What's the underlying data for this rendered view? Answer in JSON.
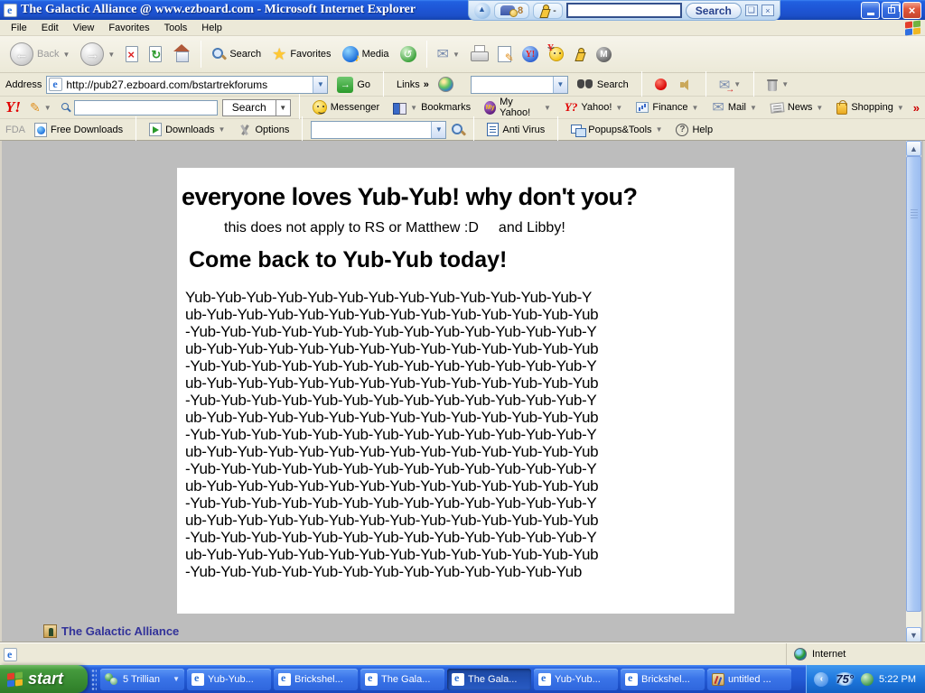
{
  "window": {
    "title": "The Galactic Alliance @ www.ezboard.com - Microsoft Internet Explorer"
  },
  "deskbar": {
    "mail_count": "8",
    "aim_status": "-",
    "search_value": "",
    "search_button": "Search"
  },
  "menu_bar": {
    "items": [
      "File",
      "Edit",
      "View",
      "Favorites",
      "Tools",
      "Help"
    ]
  },
  "toolbar": {
    "back_label": "Back",
    "search_label": "Search",
    "favorites_label": "Favorites",
    "media_label": "Media"
  },
  "address_bar": {
    "label": "Address",
    "url": "http://pub27.ezboard.com/bstartrekforums",
    "go_label": "Go",
    "links_label": "Links",
    "links_chevron": "»",
    "search_value": "",
    "search_label": "Search"
  },
  "yahoo_toolbar": {
    "logo": "Y!",
    "search_value": "",
    "search_button": "Search",
    "messenger_label": "Messenger",
    "bookmarks_label": "Bookmarks",
    "my_yahoo_label": "My Yahoo!",
    "yahoo_label": "Yahoo!",
    "finance_label": "Finance",
    "mail_label": "Mail",
    "news_label": "News",
    "shopping_label": "Shopping",
    "overflow_chevron": "»"
  },
  "fda_toolbar": {
    "fda_label": "FDA",
    "free_downloads_label": "Free Downloads",
    "downloads_label": "Downloads",
    "options_label": "Options",
    "search_value": "",
    "anti_virus_label": "Anti Virus",
    "popups_label": "Popups&Tools",
    "help_label": "Help"
  },
  "page": {
    "heading": "everyone loves Yub-Yub! why don't you?",
    "subheading_main": "this does not apply to RS or Matthew :D",
    "subheading_extra": "and Libby!",
    "heading2": "Come back to Yub-Yub today!",
    "yub_lines": [
      "Yub-Yub-Yub-Yub-Yub-Yub-Yub-Yub-Yub-Yub-Yub-Yub-Yub-Y",
      "ub-Yub-Yub-Yub-Yub-Yub-Yub-Yub-Yub-Yub-Yub-Yub-Yub-Yub",
      "-Yub-Yub-Yub-Yub-Yub-Yub-Yub-Yub-Yub-Yub-Yub-Yub-Yub-Y",
      "ub-Yub-Yub-Yub-Yub-Yub-Yub-Yub-Yub-Yub-Yub-Yub-Yub-Yub",
      "-Yub-Yub-Yub-Yub-Yub-Yub-Yub-Yub-Yub-Yub-Yub-Yub-Yub-Y",
      "ub-Yub-Yub-Yub-Yub-Yub-Yub-Yub-Yub-Yub-Yub-Yub-Yub-Yub",
      "-Yub-Yub-Yub-Yub-Yub-Yub-Yub-Yub-Yub-Yub-Yub-Yub-Yub-Y",
      "ub-Yub-Yub-Yub-Yub-Yub-Yub-Yub-Yub-Yub-Yub-Yub-Yub-Yub",
      "-Yub-Yub-Yub-Yub-Yub-Yub-Yub-Yub-Yub-Yub-Yub-Yub-Yub-Y",
      "ub-Yub-Yub-Yub-Yub-Yub-Yub-Yub-Yub-Yub-Yub-Yub-Yub-Yub",
      "-Yub-Yub-Yub-Yub-Yub-Yub-Yub-Yub-Yub-Yub-Yub-Yub-Yub-Y",
      "ub-Yub-Yub-Yub-Yub-Yub-Yub-Yub-Yub-Yub-Yub-Yub-Yub-Yub",
      "-Yub-Yub-Yub-Yub-Yub-Yub-Yub-Yub-Yub-Yub-Yub-Yub-Yub-Y",
      "ub-Yub-Yub-Yub-Yub-Yub-Yub-Yub-Yub-Yub-Yub-Yub-Yub-Yub",
      "-Yub-Yub-Yub-Yub-Yub-Yub-Yub-Yub-Yub-Yub-Yub-Yub-Yub-Y",
      "ub-Yub-Yub-Yub-Yub-Yub-Yub-Yub-Yub-Yub-Yub-Yub-Yub-Yub",
      "-Yub-Yub-Yub-Yub-Yub-Yub-Yub-Yub-Yub-Yub-Yub-Yub-Yub"
    ],
    "footer_link": "The Galactic Alliance"
  },
  "status_bar": {
    "zone_label": "Internet"
  },
  "taskbar": {
    "start_label": "start",
    "buttons": [
      {
        "label": "5 Trillian",
        "app": "trillian",
        "grouped": true,
        "active": false
      },
      {
        "label": "Yub-Yub...",
        "app": "ie",
        "active": false
      },
      {
        "label": "Brickshel...",
        "app": "ie",
        "active": false
      },
      {
        "label": "The Gala...",
        "app": "ie",
        "active": false
      },
      {
        "label": "The Gala...",
        "app": "ie",
        "active": true
      },
      {
        "label": "Yub-Yub...",
        "app": "ie",
        "active": false
      },
      {
        "label": "Brickshel...",
        "app": "ie",
        "active": false
      },
      {
        "label": "untitled ...",
        "app": "paint",
        "active": false
      }
    ],
    "tray": {
      "temperature": "75°",
      "time": "5:22 PM"
    }
  },
  "icons": {
    "back": "←",
    "forward": "→",
    "stop": "×",
    "refresh": "↻",
    "history": "↺",
    "mail": "✉",
    "star": "★",
    "pencil": "✎",
    "go_arrow": "→",
    "dropdown": "▼",
    "minimize": "–",
    "close": "×",
    "help": "?",
    "chevron_left": "‹",
    "scroll_up": "▲",
    "scroll_down": "▼",
    "m_sphere": "M",
    "my": "My",
    "y_small": "Y?",
    "yglobe": "Y!"
  }
}
